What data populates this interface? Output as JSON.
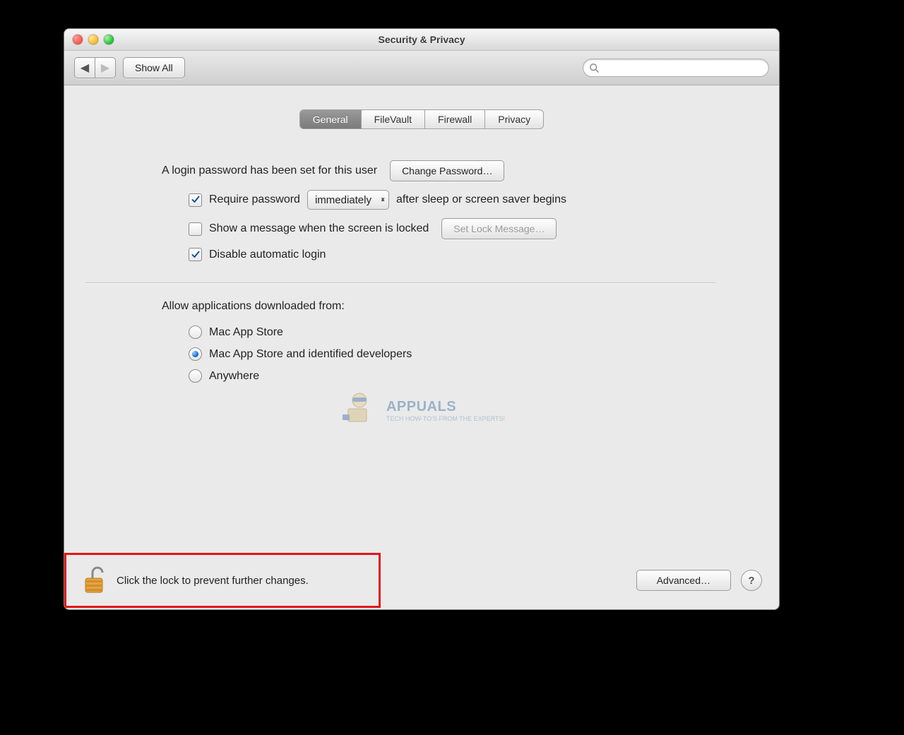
{
  "window": {
    "title": "Security & Privacy"
  },
  "toolbar": {
    "show_all_label": "Show All",
    "search_placeholder": ""
  },
  "tabs": [
    {
      "label": "General",
      "active": true
    },
    {
      "label": "FileVault",
      "active": false
    },
    {
      "label": "Firewall",
      "active": false
    },
    {
      "label": "Privacy",
      "active": false
    }
  ],
  "general": {
    "login_password_set_text": "A login password has been set for this user",
    "change_password_button": "Change Password…",
    "require_password": {
      "checked": true,
      "label": "Require password",
      "delay_selected": "immediately",
      "suffix": "after sleep or screen saver begins"
    },
    "show_lock_message": {
      "checked": false,
      "label": "Show a message when the screen is locked",
      "set_lock_message_button": "Set Lock Message…",
      "button_enabled": false
    },
    "disable_auto_login": {
      "checked": true,
      "label": "Disable automatic login"
    },
    "allow_apps": {
      "heading": "Allow applications downloaded from:",
      "options": [
        {
          "label": "Mac App Store",
          "selected": false
        },
        {
          "label": "Mac App Store and identified developers",
          "selected": true
        },
        {
          "label": "Anywhere",
          "selected": false
        }
      ]
    }
  },
  "footer": {
    "lock_text": "Click the lock to prevent further changes.",
    "advanced_button": "Advanced…",
    "help_label": "?"
  },
  "watermark": {
    "brand": "APPUALS",
    "tagline": "TECH HOW-TO'S FROM THE EXPERTS!"
  }
}
